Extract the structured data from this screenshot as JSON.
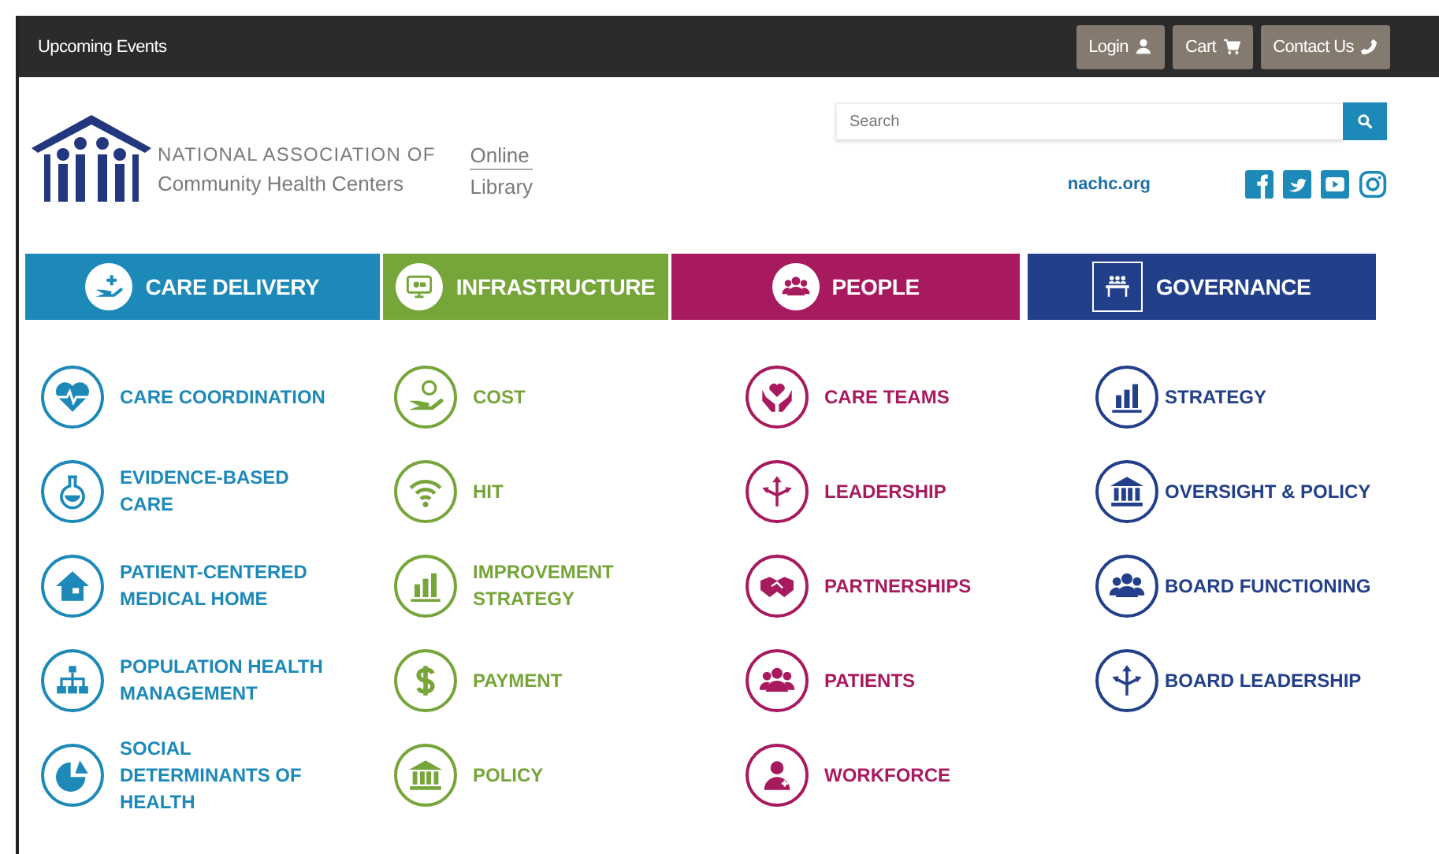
{
  "top_bar": {
    "title": "Upcoming Events",
    "buttons": [
      {
        "label": "Login",
        "kind": "user"
      },
      {
        "label": "Cart",
        "kind": "cart"
      },
      {
        "label": "Contact Us",
        "kind": "phone"
      }
    ]
  },
  "header": {
    "logo_line1": "NATIONAL ASSOCIATION OF",
    "logo_line2": "Community Health Centers",
    "library_line1": "Online",
    "library_line2": "Library",
    "search": {
      "placeholder": "Search"
    },
    "link": "nachc.org"
  },
  "categories": [
    {
      "label": "CARE DELIVERY",
      "color": "#1d89b8",
      "topics": [
        "CARE COORDINATION",
        "EVIDENCE-BASED CARE",
        "PATIENT-CENTERED MEDICAL HOME",
        "POPULATION HEALTH MANAGEMENT",
        "SOCIAL DETERMINANTS OF HEALTH"
      ]
    },
    {
      "label": "INFRASTRUCTURE",
      "color": "#76a53a",
      "topics": [
        "COST",
        "HIT",
        "IMPROVEMENT STRATEGY",
        "PAYMENT",
        "POLICY"
      ]
    },
    {
      "label": "PEOPLE",
      "color": "#a81a5e",
      "topics": [
        "CARE TEAMS",
        "LEADERSHIP",
        "PARTNERSHIPS",
        "PATIENTS",
        "WORKFORCE"
      ]
    },
    {
      "label": "GOVERNANCE",
      "color": "#223f8a",
      "topics": [
        "STRATEGY",
        "OVERSIGHT & POLICY",
        "BOARD FUNCTIONING",
        "BOARD LEADERSHIP"
      ]
    }
  ]
}
